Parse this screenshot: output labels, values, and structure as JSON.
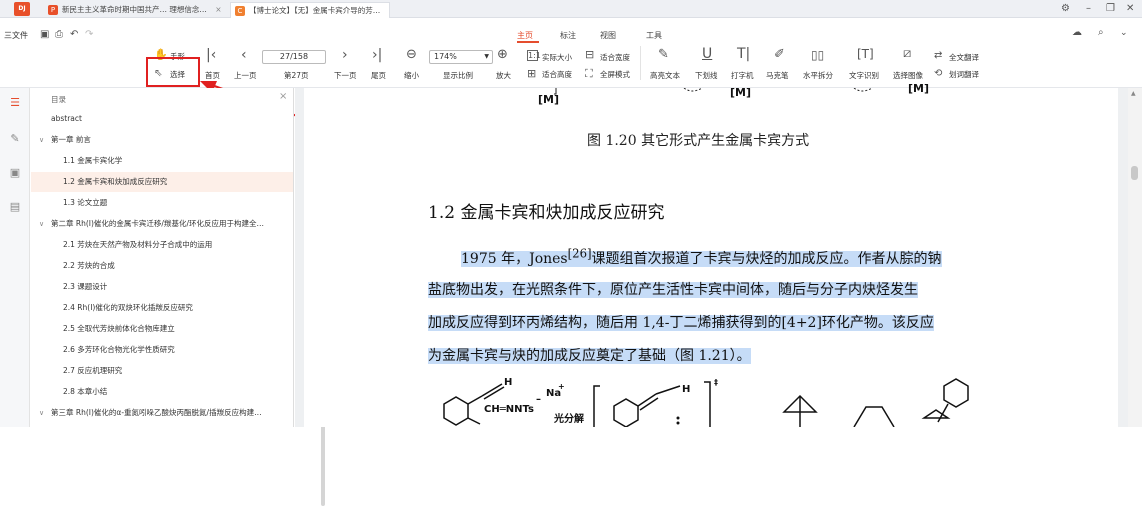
{
  "titlebar": {
    "logo": "DJ",
    "tabs": [
      {
        "icon": "P",
        "label": "新民主主义革命时期中国共产… 理想信念…",
        "close": "×"
      },
      {
        "icon": "C",
        "label": "【博士论文】【无】金属卡宾介导的芳…",
        "close": "×"
      }
    ],
    "win_controls": [
      "⚙",
      "–",
      "❐",
      "✕"
    ]
  },
  "menu": {
    "file": "三文件",
    "tabs": [
      "主页",
      "标注",
      "视图",
      "工具"
    ],
    "active": "主页"
  },
  "toolbar": {
    "hand": "手形",
    "select": "选择",
    "first_page": "首页",
    "prev_page": "上一页",
    "page_value": "27/158",
    "page_label": "第27页",
    "next_page": "下一页",
    "last_page": "尾页",
    "zoom_out": "缩小",
    "zoom_value": "174%",
    "zoom_label": "显示比例",
    "zoom_in": "放大",
    "actual_size": "实际大小",
    "fit_width": "适合宽度",
    "fit_height": "适合高度",
    "full_screen": "全屏模式",
    "highlight": "高亮文本",
    "underline": "下划线",
    "typewriter": "打字机",
    "marker": "马克笔",
    "split": "水平拆分",
    "ocr": "文字识别",
    "select_image": "选择图像",
    "translate_all": "全文翻译",
    "translate_word": "划词翻译"
  },
  "toc": {
    "title": "目录",
    "close": "×",
    "items": [
      {
        "label": "abstract",
        "level": 0,
        "chev": ""
      },
      {
        "label": "第一章 前言",
        "level": 0,
        "chev": "∨"
      },
      {
        "label": "1.1 金属卡宾化学",
        "level": 1,
        "chev": ""
      },
      {
        "label": "1.2 金属卡宾和炔加成反应研究",
        "level": 1,
        "chev": "",
        "selected": true
      },
      {
        "label": "1.3 论文立题",
        "level": 1,
        "chev": ""
      },
      {
        "label": "第二章 Rh(I)催化的金属卡宾迁移/羰基化/环化反应用于构建全…",
        "level": 0,
        "chev": "∨"
      },
      {
        "label": "2.1 芳炔在天然产物及材料分子合成中的运用",
        "level": 1,
        "chev": ""
      },
      {
        "label": "2.2 芳炔的合成",
        "level": 1,
        "chev": ""
      },
      {
        "label": "2.3 课题设计",
        "level": 1,
        "chev": ""
      },
      {
        "label": "2.4 Rh(I)催化的双炔环化插羰反应研究",
        "level": 1,
        "chev": ""
      },
      {
        "label": "2.5 全取代芳炔前体化合物库建立",
        "level": 1,
        "chev": ""
      },
      {
        "label": "2.6 多芳环化合物光化学性质研究",
        "level": 1,
        "chev": ""
      },
      {
        "label": "2.7 反应机理研究",
        "level": 1,
        "chev": ""
      },
      {
        "label": "2.8 本章小结",
        "level": 1,
        "chev": ""
      },
      {
        "label": "第三章 Rh(I)催化的α-重氮吲哚乙酸炔丙酯脱氮/插羰反应构建…",
        "level": 0,
        "chev": "∨"
      }
    ]
  },
  "doc": {
    "top_labels": [
      "[M]",
      "[M]",
      "[M]"
    ],
    "figure_caption": "图 1.20 其它形式产生金属卡宾方式",
    "section_title": "1.2 金属卡宾和炔加成反应研究",
    "paragraph": [
      {
        "pre": "1975 年，Jones",
        "sup": "[26]",
        "post": "课题组首次报道了卡宾与炔烃的加成反应。作者从腙的钠"
      },
      {
        "pre": "盐底物出发，在光照条件下，原位产生活性卡宾中间体，随后与分子内炔烃发生",
        "sup": "",
        "post": ""
      },
      {
        "pre": "加成反应得到环丙烯结构，随后用 1,4-丁二烯捕获得到的[4+2]环化产物。该反应",
        "sup": "",
        "post": ""
      },
      {
        "pre": "为金属卡宾与炔的加成反应奠定了基础（图 1.21）。",
        "sup": "",
        "post": ""
      }
    ],
    "scheme": {
      "h1": "H",
      "na": "Na",
      "plus": "+",
      "minus": "–",
      "chn": "CH═NNTs",
      "photolysis": "光分解",
      "h2": "H",
      "dagger": "‡"
    }
  },
  "colors": {
    "accent": "#e54d2e",
    "highlight": "#c6dcf7",
    "callout": "#e02020"
  }
}
